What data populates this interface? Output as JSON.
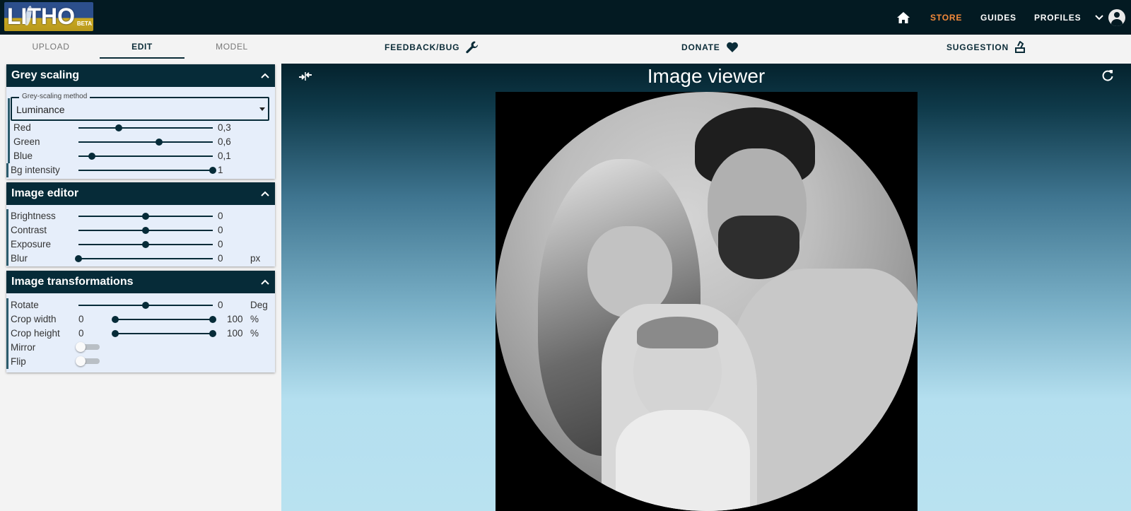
{
  "app": {
    "logo_text": "LITHO",
    "logo_badge": "BETA"
  },
  "topnav": {
    "home_icon": "home-icon",
    "store": "STORE",
    "guides": "GUIDES",
    "profiles": "PROFILES",
    "store_color": "#f58a3a"
  },
  "tabs": {
    "upload": "UPLOAD",
    "edit": "EDIT",
    "model": "MODEL",
    "active": "EDIT"
  },
  "actions": {
    "feedback": "FEEDBACK/BUG",
    "donate": "DONATE",
    "suggestion": "SUGGESTION"
  },
  "grey_scaling": {
    "title": "Grey scaling",
    "method_label": "Grey-scaling method",
    "method_value": "Luminance",
    "sliders": [
      {
        "label": "Red",
        "value": "0,3",
        "fraction": 0.3
      },
      {
        "label": "Green",
        "value": "0,6",
        "fraction": 0.6
      },
      {
        "label": "Blue",
        "value": "0,1",
        "fraction": 0.1
      },
      {
        "label": "Bg intensity",
        "value": "1",
        "fraction": 1.0
      }
    ]
  },
  "image_editor": {
    "title": "Image editor",
    "sliders": [
      {
        "label": "Brightness",
        "value": "0",
        "fraction": 0.5
      },
      {
        "label": "Contrast",
        "value": "0",
        "fraction": 0.5
      },
      {
        "label": "Exposure",
        "value": "0",
        "fraction": 0.5
      },
      {
        "label": "Blur",
        "value": "0",
        "unit": "px",
        "fraction": 0.0
      }
    ]
  },
  "image_transformations": {
    "title": "Image transformations",
    "rotate": {
      "label": "Rotate",
      "value": "0",
      "unit": "Deg",
      "fraction": 0.5
    },
    "crop_width": {
      "label": "Crop width",
      "min": "0",
      "max": "100",
      "unit": "%",
      "range": [
        0,
        1
      ]
    },
    "crop_height": {
      "label": "Crop height",
      "min": "0",
      "max": "100",
      "unit": "%",
      "range": [
        0,
        1
      ]
    },
    "mirror": {
      "label": "Mirror",
      "on": false
    },
    "flip": {
      "label": "Flip",
      "on": false
    }
  },
  "viewer": {
    "title": "Image viewer"
  },
  "colors": {
    "dark": "#062b38",
    "panel_bg": "#e6eefa",
    "accent": "#f58a3a"
  }
}
